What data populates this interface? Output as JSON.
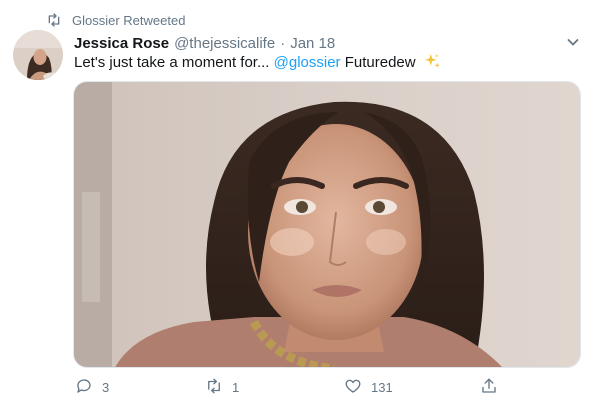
{
  "retweet_banner": {
    "text": "Glossier Retweeted"
  },
  "tweet": {
    "author_name": "Jessica Rose",
    "author_handle": "@thejessicalife",
    "separator": "·",
    "timestamp": "Jan 18",
    "text_before": "Let's just take a moment for... ",
    "mention": "@glossier",
    "text_after": " Futuredew",
    "emoji_icon": "sparkles-icon"
  },
  "actions": {
    "reply_count": "3",
    "retweet_count": "1",
    "like_count": "131"
  },
  "colors": {
    "link": "#1da1f2",
    "secondary_text": "#657786",
    "primary_text": "#14171a",
    "sparkle": "#f5c33b"
  }
}
